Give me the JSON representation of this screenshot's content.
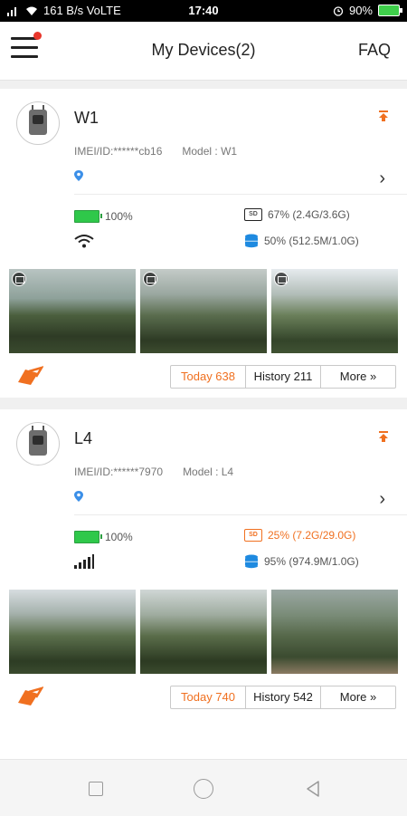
{
  "statusbar": {
    "left": "161 B/s VoLTE",
    "time": "17:40",
    "battery": "90%"
  },
  "header": {
    "title": "My Devices(2)",
    "faq": "FAQ"
  },
  "devices": [
    {
      "name": "W1",
      "imei": "IMEI/ID:******cb16",
      "model": "Model : W1",
      "battery": "100%",
      "storage": "67%  (2.4G/3.6G)",
      "cloud": "50%  (512.5M/1.0G)",
      "signal": "wifi",
      "tabs": {
        "today": "Today 638",
        "history": "History 211",
        "more": "More »"
      }
    },
    {
      "name": "L4",
      "imei": "IMEI/ID:******7970",
      "model": "Model : L4",
      "battery": "100%",
      "storage": "25%  (7.2G/29.0G)",
      "cloud": "95%  (974.9M/1.0G)",
      "signal": "cellular",
      "tabs": {
        "today": "Today 740",
        "history": "History 542",
        "more": "More »"
      }
    }
  ],
  "colors": {
    "accent": "#f07020",
    "battery_green": "#2fc84a",
    "link_blue": "#3b8fe8"
  },
  "icons": [
    "menu-icon",
    "pin-top-icon",
    "location-icon",
    "chevron-right-icon",
    "sd-card-icon",
    "cloud-storage-icon",
    "wifi-icon",
    "cellular-signal-icon",
    "share-icon",
    "photo-badge-icon"
  ]
}
